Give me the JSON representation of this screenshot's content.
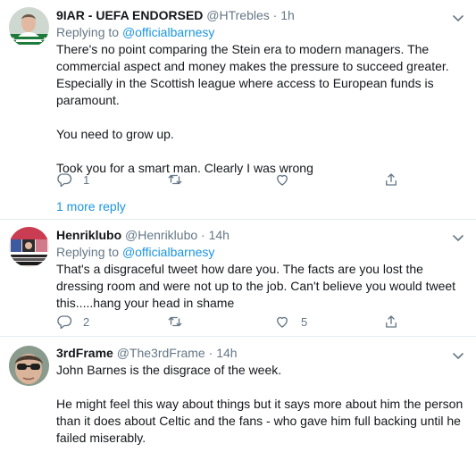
{
  "tweets": [
    {
      "display_name": "9IAR - UEFA ENDORSED",
      "handle": "@HTrebles",
      "separator": "·",
      "time": "1h",
      "reply_prefix": "Replying to ",
      "reply_to": "@officialbarnesy",
      "paragraphs": [
        "There's no point comparing the Stein era to modern managers. The commercial aspect and money makes the pressure to succeed greater. Especially in the Scottish league where access to European funds is paramount.",
        "You need to grow up.",
        "Took you for a smart man. Clearly I was wrong"
      ],
      "reply_count": "1",
      "retweet_count": "",
      "like_count": "",
      "avatar_icon": "celtic-hoops-avatar"
    },
    {
      "display_name": "Henriklubo",
      "handle": "@Henriklubo",
      "separator": "·",
      "time": "14h",
      "reply_prefix": "Replying to ",
      "reply_to": "@officialbarnesy",
      "paragraphs": [
        "That's a disgraceful tweet how dare you. The facts are you lost the dressing room and were not up to the job. Can't believe you would tweet this.....hang your head in shame"
      ],
      "reply_count": "2",
      "retweet_count": "",
      "like_count": "5",
      "avatar_icon": "collage-avatar"
    },
    {
      "display_name": "3rdFrame",
      "handle": "@The3rdFrame",
      "separator": "·",
      "time": "14h",
      "paragraphs": [
        "John Barnes is the disgrace of the week.",
        "He might feel this way about things but it says more about him the person than it does about Celtic and the fans - who gave him full backing until he failed miserably."
      ],
      "avatar_icon": "sunglasses-avatar"
    }
  ],
  "more_replies_label": "1 more reply",
  "colors": {
    "link": "#1b95e0",
    "secondary_text": "#657786",
    "divider": "#e6ecf0"
  }
}
